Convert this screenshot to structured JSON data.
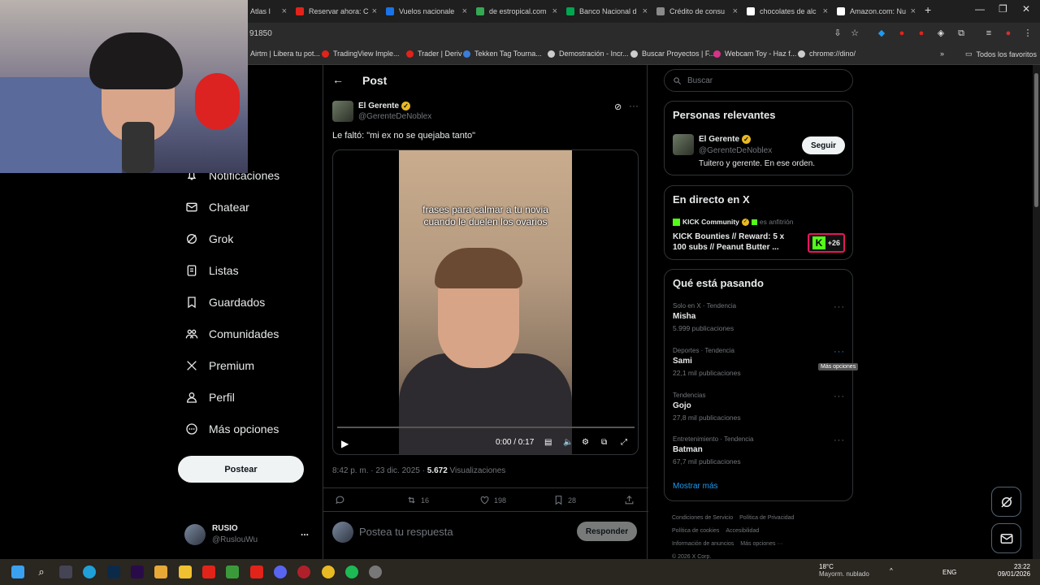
{
  "browser": {
    "tabs": [
      {
        "title": "Atlas I",
        "color": "#1d9bf0"
      },
      {
        "title": "Reservar ahora: C",
        "color": "#e2231a"
      },
      {
        "title": "Vuelos nacionale",
        "color": "#1a73e8"
      },
      {
        "title": "de estropical.com",
        "color": "#34a853"
      },
      {
        "title": "Banco Nacional d",
        "color": "#00a650"
      },
      {
        "title": "Crédito de consu",
        "color": "#8a8a8a"
      },
      {
        "title": "chocolates de alc",
        "color": "#ffffff"
      },
      {
        "title": "Amazon.com: Nu",
        "color": "#ffffff"
      }
    ],
    "new_tab": "+",
    "url": "91850",
    "bookmarks": [
      {
        "label": "Airtm | Libera tu pot...",
        "color": "#00d3a5"
      },
      {
        "label": "TradingView Imple...",
        "color": "#e2231a"
      },
      {
        "label": "Trader | Deriv",
        "color": "#e2231a"
      },
      {
        "label": "Tekken Tag Tourna...",
        "color": "#3b7dd8"
      },
      {
        "label": "Demostración - Incr...",
        "color": "#cccccc"
      },
      {
        "label": "Buscar Proyectos | F...",
        "color": "#cccccc"
      },
      {
        "label": "Webcam Toy - Haz f...",
        "color": "#d6338a"
      },
      {
        "label": "chrome://dino/",
        "color": "#cccccc"
      }
    ],
    "all_favorites": "Todos los favoritos"
  },
  "nav": {
    "items": [
      {
        "label": "Notificaciones",
        "icon": "bell"
      },
      {
        "label": "Chatear",
        "icon": "mail"
      },
      {
        "label": "Grok",
        "icon": "grok"
      },
      {
        "label": "Listas",
        "icon": "list"
      },
      {
        "label": "Guardados",
        "icon": "bookmark"
      },
      {
        "label": "Comunidades",
        "icon": "people"
      },
      {
        "label": "Premium",
        "icon": "x-logo"
      },
      {
        "label": "Perfil",
        "icon": "person"
      },
      {
        "label": "Más opciones",
        "icon": "more-circle"
      }
    ],
    "post_button": "Postear",
    "account": {
      "name": "RUSIO",
      "handle": "@RuslouWu",
      "more": "..."
    }
  },
  "post": {
    "header": "Post",
    "author": {
      "name": "El Gerente",
      "handle": "@GerenteDeNoblex"
    },
    "text": "Le faltó: \"mi ex no se quejaba tanto\"",
    "video": {
      "caption_line1": "frases para calmar a tu novia",
      "caption_line2": "cuando le duelen los ovarios",
      "time": "0:00 / 0:17",
      "progress": 0.0
    },
    "timestamp": "8:42 p. m. · 23 dic. 2025 · ",
    "views_count": "5.672",
    "views_label": " Visualizaciones",
    "retweets": "16",
    "likes": "198",
    "bookmarks": "28",
    "reply_placeholder": "Postea tu respuesta",
    "reply_button": "Responder"
  },
  "right": {
    "search_placeholder": "Buscar",
    "relevant": {
      "title": "Personas relevantes",
      "name": "El Gerente",
      "handle": "@GerenteDeNoblex",
      "bio": "Tuitero y gerente. En ese orden.",
      "follow": "Seguir"
    },
    "live": {
      "title": "En directo en X",
      "host": "KICK Community",
      "host_suffix": "es anfitrión",
      "text_line1": "KICK Bounties // Reward: 5 x",
      "text_line2": "100 subs // Peanut Butter ...",
      "extra": "+26"
    },
    "trends": {
      "title": "Qué está pasando",
      "items": [
        {
          "meta": "Solo en X · Tendencia",
          "name": "Misha",
          "count": "5.999 publicaciones"
        },
        {
          "meta": "Deportes · Tendencia",
          "name": "Sami",
          "count": "22,1 mil publicaciones"
        },
        {
          "meta": "Tendencias",
          "name": "Gojo",
          "count": "27,8 mil publicaciones"
        },
        {
          "meta": "Entretenimiento · Tendencia",
          "name": "Batman",
          "count": "67,7 mil publicaciones"
        }
      ],
      "show_more": "Mostrar más",
      "tooltip": "Más opciones"
    },
    "footer": [
      "Condiciones de Servicio",
      "Política de Privacidad",
      "Política de cookies",
      "Accesibilidad",
      "Información de anuncios",
      "Más opciones ···",
      "© 2026 X Corp."
    ]
  },
  "taskbar": {
    "weather_temp": "18°C",
    "weather_desc": "Mayorm. nublado",
    "lang": "ENG",
    "time": "23:22",
    "date": "09/01/2026"
  },
  "colors": {
    "accent": "#1d9bf0",
    "verified": "#e8b923",
    "kick": "#53fc18"
  }
}
